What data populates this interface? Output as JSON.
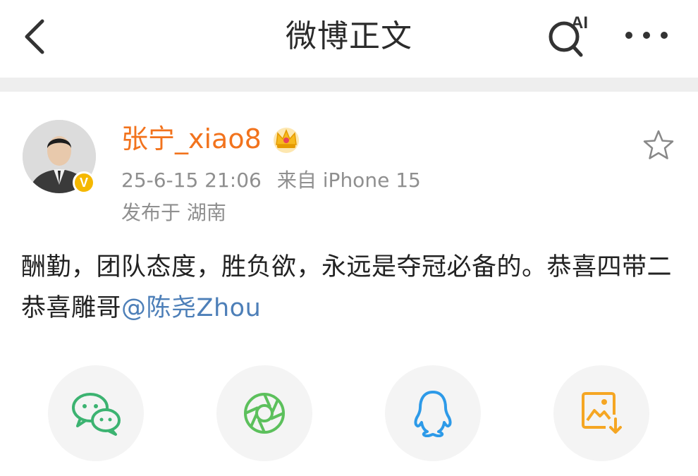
{
  "header": {
    "title": "微博正文",
    "back_icon": "chevron-left-icon",
    "ai_search_icon": "ai-search-icon",
    "ai_search_label": "AI",
    "more_icon": "more-horizontal-icon"
  },
  "post": {
    "author": "张宁_xiao8",
    "author_color": "#f2731d",
    "verified_badge_label": "V",
    "timestamp": "25-6-15 21:06",
    "source": "来自 iPhone 15",
    "location": "发布于 湖南",
    "body_text": "酬勤，团队态度，胜负欲，永远是夺冠必备的。恭喜四带二恭喜雕哥",
    "mention": "@陈尧Zhou",
    "mention_color": "#4d7fb8"
  },
  "share": {
    "buttons": [
      {
        "icon": "wechat-icon",
        "color": "#3cb371"
      },
      {
        "icon": "moments-icon",
        "color": "#5cc05c"
      },
      {
        "icon": "qq-icon",
        "color": "#2d9ae8"
      },
      {
        "icon": "save-image-icon",
        "color": "#f5a623"
      }
    ]
  }
}
